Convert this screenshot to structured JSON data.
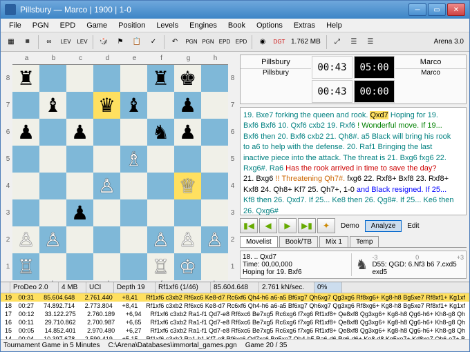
{
  "title": "Pillsbury — Marco | 1900 | 1-0",
  "menu": [
    "File",
    "PGN",
    "EPD",
    "Game",
    "Position",
    "Levels",
    "Engines",
    "Book",
    "Options",
    "Extras",
    "Help"
  ],
  "toolbar": {
    "mem": "1.762 MB",
    "app": "Arena 3.0"
  },
  "clocks": {
    "p1": "Pillsbury",
    "p2": "Marco",
    "t1a": "00:43",
    "t1b": "00:43",
    "t2a": "05:00",
    "t2b": "00:00",
    "lbl1": "Pillsbury",
    "lbl2": "Marco"
  },
  "analysis": {
    "l1a": "19. Bxe7 forking the queen and rook.",
    "l1b": "Qxd7",
    "l1c": " Hoping for 19.",
    "l2": "Bxf6 Bxf6 10. Qxf6 cxb2 19. Rxf6",
    "l2b": "! Wonderful move. If 19...",
    "l3": "Bxf6 then 20. Bxf6 cxb2 21. Qh8#. a5",
    "l3b": "Black will bring his rook",
    "l4": "to a6 to help with the defense. 20. Raf1",
    "l4b": "Bringing the last",
    "l5": "inactive piece into the attack. The threat is 21. Bxg6 fxg6 22.",
    "l6": "Rxg6#. Ra6",
    "l6b": "Has the rook arrived in time to save the day?",
    "l7a": "21. Bxg6",
    "l7b": "!! Threatening Qh7#.",
    "l7c": "fxg6 22. Rxf8+ Bxf8 23. Rxf8+",
    "l8": "Kxf8 24. Qh8+ Kf7 25. Qh7+, 1-0",
    "l8b": "and Black resigned. If 25...",
    "l9": "Kf8 then 26. Qxd7. If 25... Ke8 then 26. Qg8#. If 25... Ke6 then",
    "l10": "26. Qxg6#"
  },
  "nav": {
    "demo": "Demo",
    "analyze": "Analyze",
    "edit": "Edit"
  },
  "tabs": [
    "Movelist",
    "Book/TB",
    "Mix 1",
    "Temp"
  ],
  "info": {
    "move": "18. .. Qxd7",
    "time": "Time: 00,00,000",
    "hope": "Hoping for 19. Bxf6",
    "scale_a": "-3",
    "scale_b": "0",
    "scale_c": "+3",
    "eco": "D55: QGD: 6.Nf3 b6 7.cxd5 exd5"
  },
  "engine": {
    "name": "ProDeo 2.0",
    "mb": "4 MB",
    "uci": "UCI",
    "depth": "Depth 19",
    "best": "Rf1xf6 (1/46)",
    "nodes": "85.604.648",
    "nps": "2.761 kN/sec.",
    "pct": "0%",
    "rows": [
      {
        "d": "19",
        "t": "00:31",
        "n": "85.604.648",
        "k": "2.761.440",
        "s": "+8,41",
        "pv": "Rf1xf6 c3xb2 Rf6xc6 Ke8-d7 Rc6xf6 Qh4-h6 a6-a5 Bf6xg7 Qh6xg7 Qg3xg6 Rf8xg6+ Kg8-h8 Bg5xe7 Rf8xf1+ Kg1xf"
      },
      {
        "d": "18",
        "t": "00:27",
        "n": "74.892.714",
        "k": "2.773.804",
        "s": "+8,41",
        "pv": "Rf1xf6 c3xb2 Rf6xc6 Ke8-d7 Rc6xf6 Qh4-h6 a6-a5 Bf6xg7 Qh6xg7 Qg3xg6 Rf8xg6+ Kg8-h8 Bg5xe7 Rf8xf1+ Kg1xf"
      },
      {
        "d": "17",
        "t": "00:12",
        "n": "33.122.275",
        "k": "2.760.189",
        "s": "+6,94",
        "pv": "Rf1xf6 c3xb2 Ra1-f1 Qd7-e8 Rf6xc6 Be7xg5 Rc6xg6 f7xg6 Rf1xf8+ Qe8xf8 Qg3xg6+ Kg8-h8 Qg6-h6+ Kh8-g8 Qh"
      },
      {
        "d": "16",
        "t": "00:11",
        "n": "29.710.862",
        "k": "2.700.987",
        "s": "+6,65",
        "pv": "Rf1xf6 c3xb2 Ra1-f1 Qd7-e8 Rf6xc6 Be7xg5 Rc6xg6 f7xg6 Rf1xf8+ Qe8xf8 Qg3xg6+ Kg8-h8 Qg6-h6+ Kh8-g8 Qh"
      },
      {
        "d": "15",
        "t": "00:05",
        "n": "14.852.401",
        "k": "2.970.480",
        "s": "+6,27",
        "pv": "Rf1xf6 c3xb2 Ra1-f1 Qd7-e8 Rf6xc6 Be7xg5 Rc6xg6 f7xg6 Rf1xf8+ Qe8xf8 Qg3xg6+ Kg8-h8 Qg6-h6+ Kh8-g8 Qh"
      },
      {
        "d": "14",
        "t": "00:04",
        "n": "10.397.678",
        "k": "2.599.419",
        "s": "+5,15",
        "pv": "Rf1xf6 c3xb2 Ra1-b1 Kf7-e8 Rf6xc6 Qd7xc6 Bg5xe7 Qh4-h5 Ra6-d6 Rg6-d6+ Ke8-d8 Kg5xe7+ Kd8xe7 Qh6-e7+ B"
      }
    ]
  },
  "status": {
    "a": "Tournament Game in 5 Minutes",
    "b": "C:\\Arena\\Databases\\immortal_games.pgn",
    "c": "Game 20 / 35"
  },
  "board": {
    "files": [
      "a",
      "b",
      "c",
      "d",
      "e",
      "f",
      "g",
      "h"
    ],
    "ranks": [
      "8",
      "7",
      "6",
      "5",
      "4",
      "3",
      "2",
      "1"
    ],
    "pos": [
      [
        "♜",
        "",
        "",
        "",
        "",
        "♜",
        "♚",
        ""
      ],
      [
        "",
        "♝",
        "",
        "♛",
        "♝",
        "",
        "♟",
        ""
      ],
      [
        "♟",
        "",
        "♟",
        "",
        "",
        "♞",
        "♟",
        ""
      ],
      [
        "",
        "",
        "",
        "",
        "♗",
        "",
        "",
        ""
      ],
      [
        "",
        "",
        "",
        "♙",
        "",
        "",
        "♕",
        ""
      ],
      [
        "",
        "",
        "♟",
        "",
        "",
        "",
        "",
        ""
      ],
      [
        "♙",
        "♙",
        "",
        "",
        "",
        "♙",
        "♙",
        "♙"
      ],
      [
        "♖",
        "",
        "",
        "",
        "",
        "♖",
        "♔",
        ""
      ]
    ],
    "hl": [
      "d7",
      "g4"
    ]
  }
}
